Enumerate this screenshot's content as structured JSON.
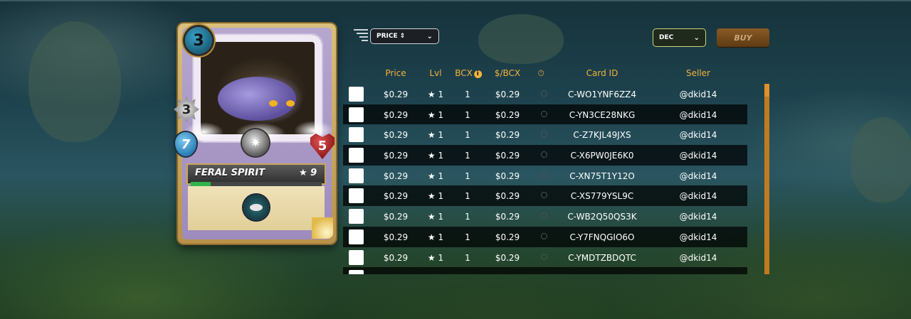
{
  "card": {
    "name": "FERAL SPIRIT",
    "level": "★ 9",
    "mana": "3",
    "attack": "3",
    "speed": "7",
    "health": "5",
    "xp_progress_percent": 15
  },
  "controls": {
    "sort_value": "PRICE ⇕",
    "currency_value": "DEC",
    "buy_label": "BUY",
    "chevron": "⌄"
  },
  "table": {
    "headers": {
      "price": "Price",
      "lvl": "Lvl",
      "bcx": "BCX",
      "bcx_info": "i",
      "per_bcx": "$/BCX",
      "time": "⏱",
      "card_id": "Card ID",
      "seller": "Seller"
    },
    "rows": [
      {
        "price": "$0.29",
        "lvl": "★ 1",
        "bcx": "1",
        "per_bcx": "$0.29",
        "card_id": "C-WO1YNF6ZZ4",
        "seller": "@dkid14"
      },
      {
        "price": "$0.29",
        "lvl": "★ 1",
        "bcx": "1",
        "per_bcx": "$0.29",
        "card_id": "C-YN3CE28NKG",
        "seller": "@dkid14"
      },
      {
        "price": "$0.29",
        "lvl": "★ 1",
        "bcx": "1",
        "per_bcx": "$0.29",
        "card_id": "C-Z7KJL49JXS",
        "seller": "@dkid14"
      },
      {
        "price": "$0.29",
        "lvl": "★ 1",
        "bcx": "1",
        "per_bcx": "$0.29",
        "card_id": "C-X6PW0JE6K0",
        "seller": "@dkid14"
      },
      {
        "price": "$0.29",
        "lvl": "★ 1",
        "bcx": "1",
        "per_bcx": "$0.29",
        "card_id": "C-XN75T1Y12O",
        "seller": "@dkid14"
      },
      {
        "price": "$0.29",
        "lvl": "★ 1",
        "bcx": "1",
        "per_bcx": "$0.29",
        "card_id": "C-XS779YSL9C",
        "seller": "@dkid14"
      },
      {
        "price": "$0.29",
        "lvl": "★ 1",
        "bcx": "1",
        "per_bcx": "$0.29",
        "card_id": "C-WB2Q50QS3K",
        "seller": "@dkid14"
      },
      {
        "price": "$0.29",
        "lvl": "★ 1",
        "bcx": "1",
        "per_bcx": "$0.29",
        "card_id": "C-Y7FNQGIO6O",
        "seller": "@dkid14"
      },
      {
        "price": "$0.29",
        "lvl": "★ 1",
        "bcx": "1",
        "per_bcx": "$0.29",
        "card_id": "C-YMDTZBDQTC",
        "seller": "@dkid14"
      },
      {
        "price": "",
        "lvl": "",
        "bcx": "",
        "per_bcx": "",
        "card_id": "",
        "seller": ""
      }
    ]
  },
  "icons": {
    "filter": "filter-lines-icon",
    "element": "neutral-element-icon",
    "ability": "ability-icon",
    "clock": "clock-icon"
  },
  "colors": {
    "header_text": "#f3b23c",
    "scrollbar": "#c07a22",
    "buy_button": "#6e4519"
  }
}
